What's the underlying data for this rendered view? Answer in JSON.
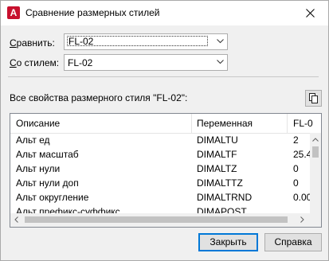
{
  "window": {
    "title": "Сравнение размерных стилей",
    "app_icon_letter": "A"
  },
  "compare": {
    "label": "Сравнить:",
    "underline_char": "С",
    "label_rest": "равнить:",
    "value": "FL-02"
  },
  "with_style": {
    "label_underline": "С",
    "label_rest": "о стилем:",
    "value": "FL-02"
  },
  "section": {
    "label": "Все свойства размерного стиля \"FL-02\":"
  },
  "table": {
    "headers": [
      "Описание",
      "Переменная",
      "FL-0"
    ],
    "rows": [
      {
        "desc": "Альт ед",
        "var": "DIMALTU",
        "val": "2"
      },
      {
        "desc": "Альт масштаб",
        "var": "DIMALTF",
        "val": "25.4"
      },
      {
        "desc": "Альт нули",
        "var": "DIMALTZ",
        "val": "0"
      },
      {
        "desc": "Альт нули доп",
        "var": "DIMALTTZ",
        "val": "0"
      },
      {
        "desc": "Альт округление",
        "var": "DIMALTRND",
        "val": "0.00"
      },
      {
        "desc": "Альт префикс-суффикс",
        "var": "DIMAPOST",
        "val": ""
      }
    ]
  },
  "buttons": {
    "close": "Закрыть",
    "help": "Справка"
  },
  "colors": {
    "accent": "#0078d7",
    "brand_red": "#c8102e"
  }
}
